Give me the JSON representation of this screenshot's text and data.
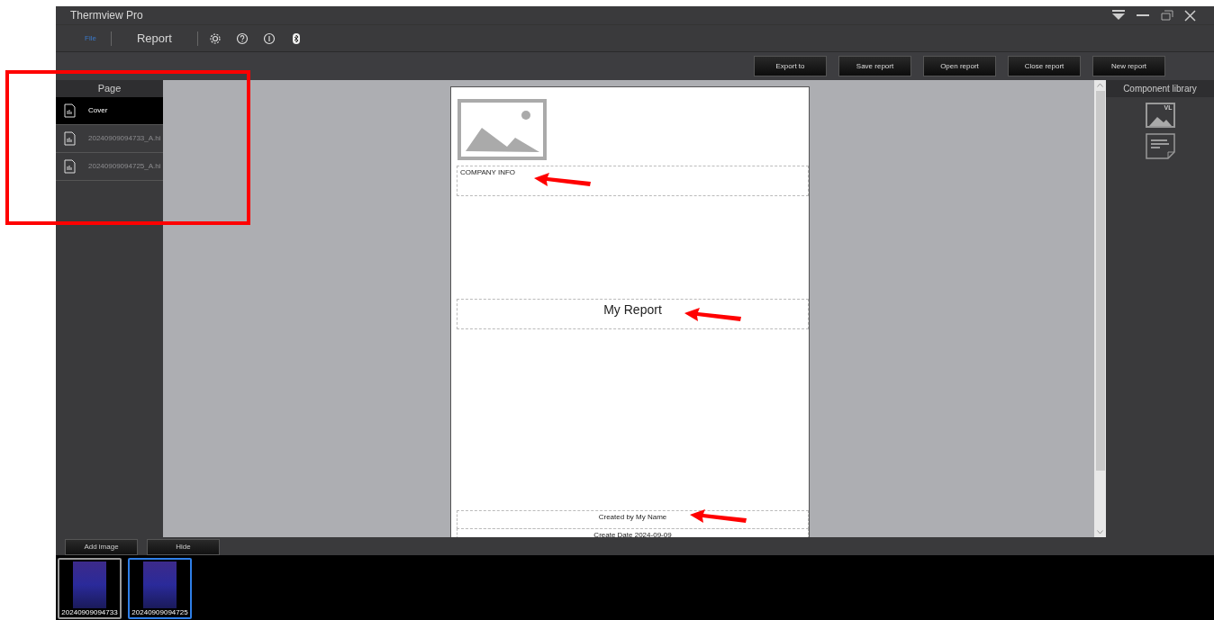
{
  "window": {
    "title": "Thermview Pro"
  },
  "menu": [
    {
      "label": "File",
      "kind": "small",
      "selected": true
    },
    {
      "label": "Report",
      "kind": "large",
      "selected": false
    }
  ],
  "toolbar_buttons": [
    "Export to",
    "Save report",
    "Open report",
    "Close report",
    "New report"
  ],
  "pages_panel": {
    "title": "Page",
    "items": [
      {
        "label": "Cover",
        "selected": true
      },
      {
        "label": "20240909094733_A.hi",
        "selected": false
      },
      {
        "label": "20240909094725_A.hi",
        "selected": false
      }
    ]
  },
  "report_page": {
    "company_info": "COMPANY INFO",
    "title": "My Report",
    "created_by": "Created by My Name",
    "create_date": "Create Date 2024-09-09"
  },
  "component_library": {
    "title": "Component library",
    "items": [
      {
        "kind": "image",
        "label": "VL"
      },
      {
        "kind": "text"
      }
    ]
  },
  "bottom_buttons": [
    "Add image",
    "Hide"
  ],
  "thumbnails": [
    {
      "caption": "20240909094733",
      "selected": false
    },
    {
      "caption": "20240909094725",
      "selected": true
    }
  ]
}
